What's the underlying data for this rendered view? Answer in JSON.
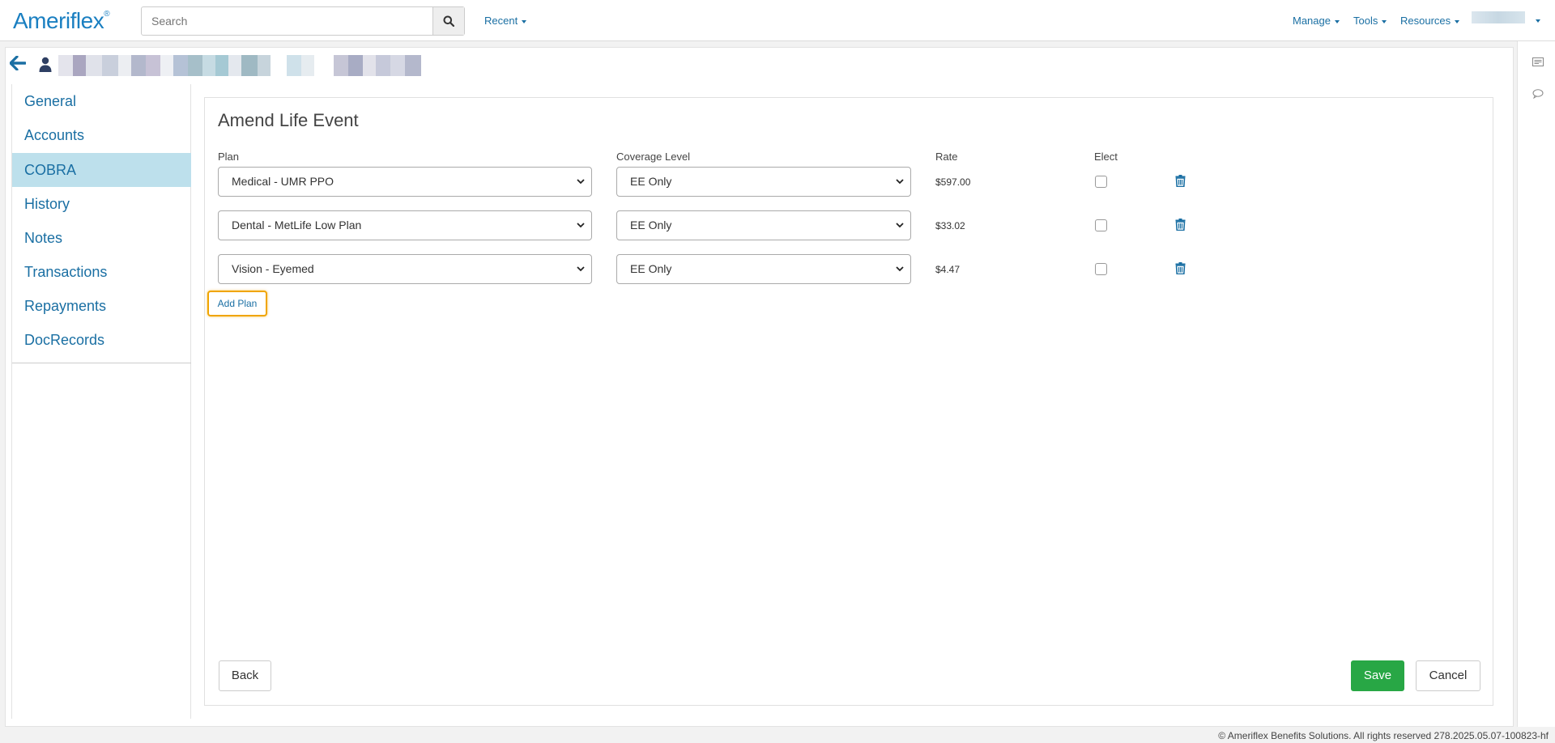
{
  "header": {
    "logo_text": "Ameriflex",
    "logo_mark": "®",
    "search_placeholder": "Search",
    "recent_label": "Recent",
    "manage_label": "Manage",
    "tools_label": "Tools",
    "resources_label": "Resources"
  },
  "sidebar": {
    "items": [
      {
        "label": "General"
      },
      {
        "label": "Accounts"
      },
      {
        "label": "COBRA"
      },
      {
        "label": "History"
      },
      {
        "label": "Notes"
      },
      {
        "label": "Transactions"
      },
      {
        "label": "Repayments"
      },
      {
        "label": "DocRecords"
      }
    ],
    "active": "COBRA"
  },
  "main": {
    "title": "Amend Life Event",
    "columns": {
      "plan": "Plan",
      "coverage": "Coverage Level",
      "rate": "Rate",
      "elect": "Elect"
    },
    "rows": [
      {
        "plan": "Medical - UMR PPO",
        "coverage": "EE Only",
        "rate": "$597.00",
        "elect": false
      },
      {
        "plan": "Dental - MetLife Low Plan",
        "coverage": "EE Only",
        "rate": "$33.02",
        "elect": false
      },
      {
        "plan": "Vision - Eyemed",
        "coverage": "EE Only",
        "rate": "$4.47",
        "elect": false
      }
    ],
    "add_plan_label": "Add Plan",
    "back_label": "Back",
    "save_label": "Save",
    "cancel_label": "Cancel"
  },
  "footer": {
    "text": "© Ameriflex Benefits Solutions. All rights reserved 278.2025.05.07-100823-hf"
  },
  "colors": {
    "brand": "#1a7fc1",
    "link": "#1a6fa3",
    "active_nav": "#bde0ec",
    "save": "#28a745",
    "focus": "#f0a500"
  }
}
